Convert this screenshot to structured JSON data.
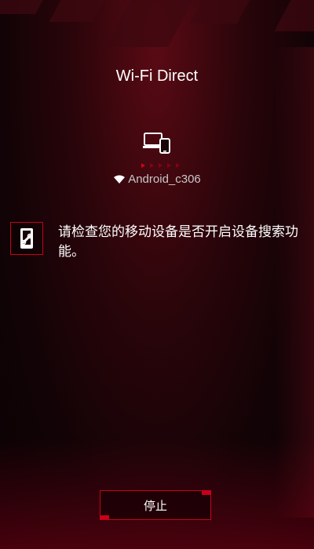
{
  "page": {
    "title": "Wi-Fi Direct"
  },
  "connection": {
    "device_icon": "laptop-phone-icon",
    "network_icon": "wifi-icon",
    "network_name": "Android_c306"
  },
  "hint": {
    "icon": "phone-link-icon",
    "text": "请检查您的移动设备是否开启设备搜索功能。"
  },
  "actions": {
    "stop_label": "停止"
  },
  "colors": {
    "accent": "#c9001a",
    "background": "#1a0408"
  }
}
